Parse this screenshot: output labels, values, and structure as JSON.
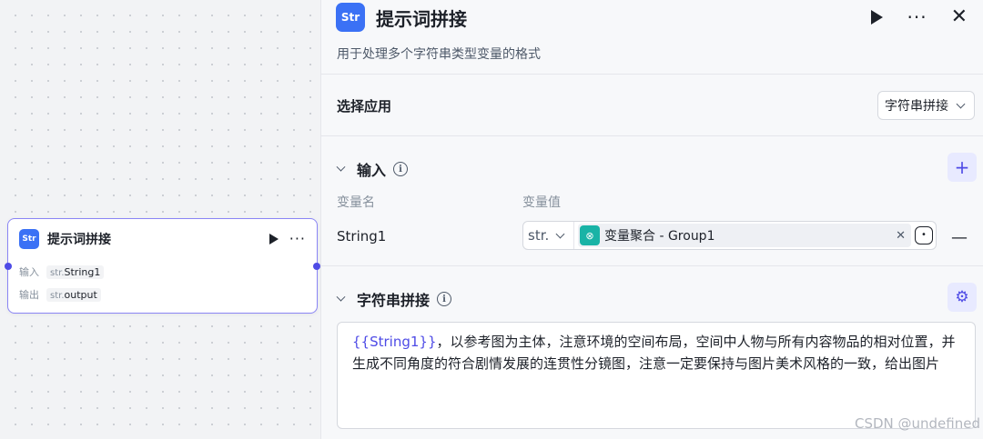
{
  "canvas_node": {
    "title": "提示词拼接",
    "icon": "string-icon",
    "input_label": "输入",
    "input_type": "str.",
    "input_value": "String1",
    "output_label": "输出",
    "output_type": "str.",
    "output_value": "output"
  },
  "panel": {
    "icon_text": "Str",
    "title": "提示词拼接",
    "description": "用于处理多个字符串类型变量的格式",
    "actions": [
      "run-icon",
      "more-icon",
      "close-icon"
    ]
  },
  "app_section": {
    "label": "选择应用",
    "selected": "字符串拼接"
  },
  "input_section": {
    "title": "输入",
    "col_name": "变量名",
    "col_value": "变量值",
    "rows": [
      {
        "name": "String1",
        "type": "str.",
        "ref_label": "变量聚合 - Group1"
      }
    ]
  },
  "concat_section": {
    "title": "字符串拼接",
    "var_ref": "{{String1}}",
    "text": "，以参考图为主体，注意环境的空间布局，空间中人物与所有内容物品的相对位置，并生成不同角度的符合剧情发展的连贯性分镜图，注意一定要保持与图片美术风格的一致，给出图片"
  },
  "watermark": "CSDN @undefined",
  "colors": {
    "accent": "#4e4be6",
    "app_icon": "#3b71f5",
    "chip_icon": "#19b3a6"
  }
}
